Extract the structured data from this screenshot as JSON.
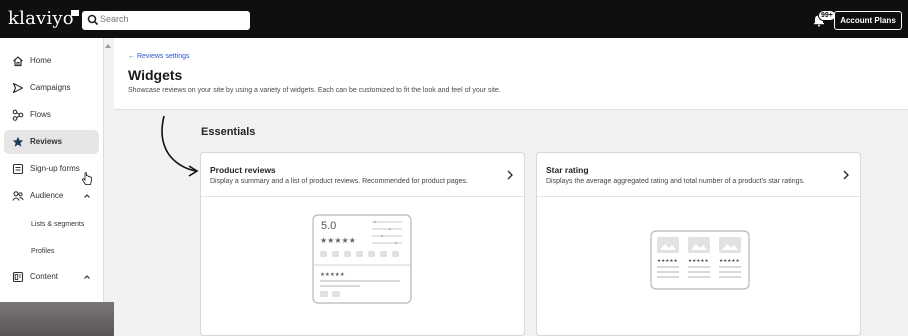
{
  "topbar": {
    "logo": "klaviyo",
    "search_placeholder": "Search",
    "notification_badge": "99+",
    "account_button": "Account Plans"
  },
  "sidebar": {
    "items": [
      {
        "label": "Home",
        "icon": "home-icon"
      },
      {
        "label": "Campaigns",
        "icon": "send-icon"
      },
      {
        "label": "Flows",
        "icon": "flows-icon"
      },
      {
        "label": "Reviews",
        "icon": "star-icon",
        "active": true
      },
      {
        "label": "Sign-up forms",
        "icon": "form-icon"
      },
      {
        "label": "Audience",
        "icon": "audience-icon"
      },
      {
        "label": "Content",
        "icon": "content-icon"
      }
    ],
    "audience_sub": [
      "Lists & segments",
      "Profiles"
    ]
  },
  "header": {
    "back_link": "Reviews settings",
    "title": "Widgets",
    "description": "Showcase reviews on your site by using a variety of widgets. Each can be customized to fit the look and feel of your site."
  },
  "section": {
    "title": "Essentials"
  },
  "cards": [
    {
      "title": "Product reviews",
      "description": "Display a summary and a list of product reviews. Recommended for product pages.",
      "rating_value": "5.0"
    },
    {
      "title": "Star rating",
      "description": "Displays the average aggregated rating and total number of a product's star ratings."
    }
  ],
  "colors": {
    "topbar": "#0f0f10",
    "link": "#2a56c6",
    "active_nav": "#e6e6e6",
    "page_bg": "#f2f2f2"
  }
}
